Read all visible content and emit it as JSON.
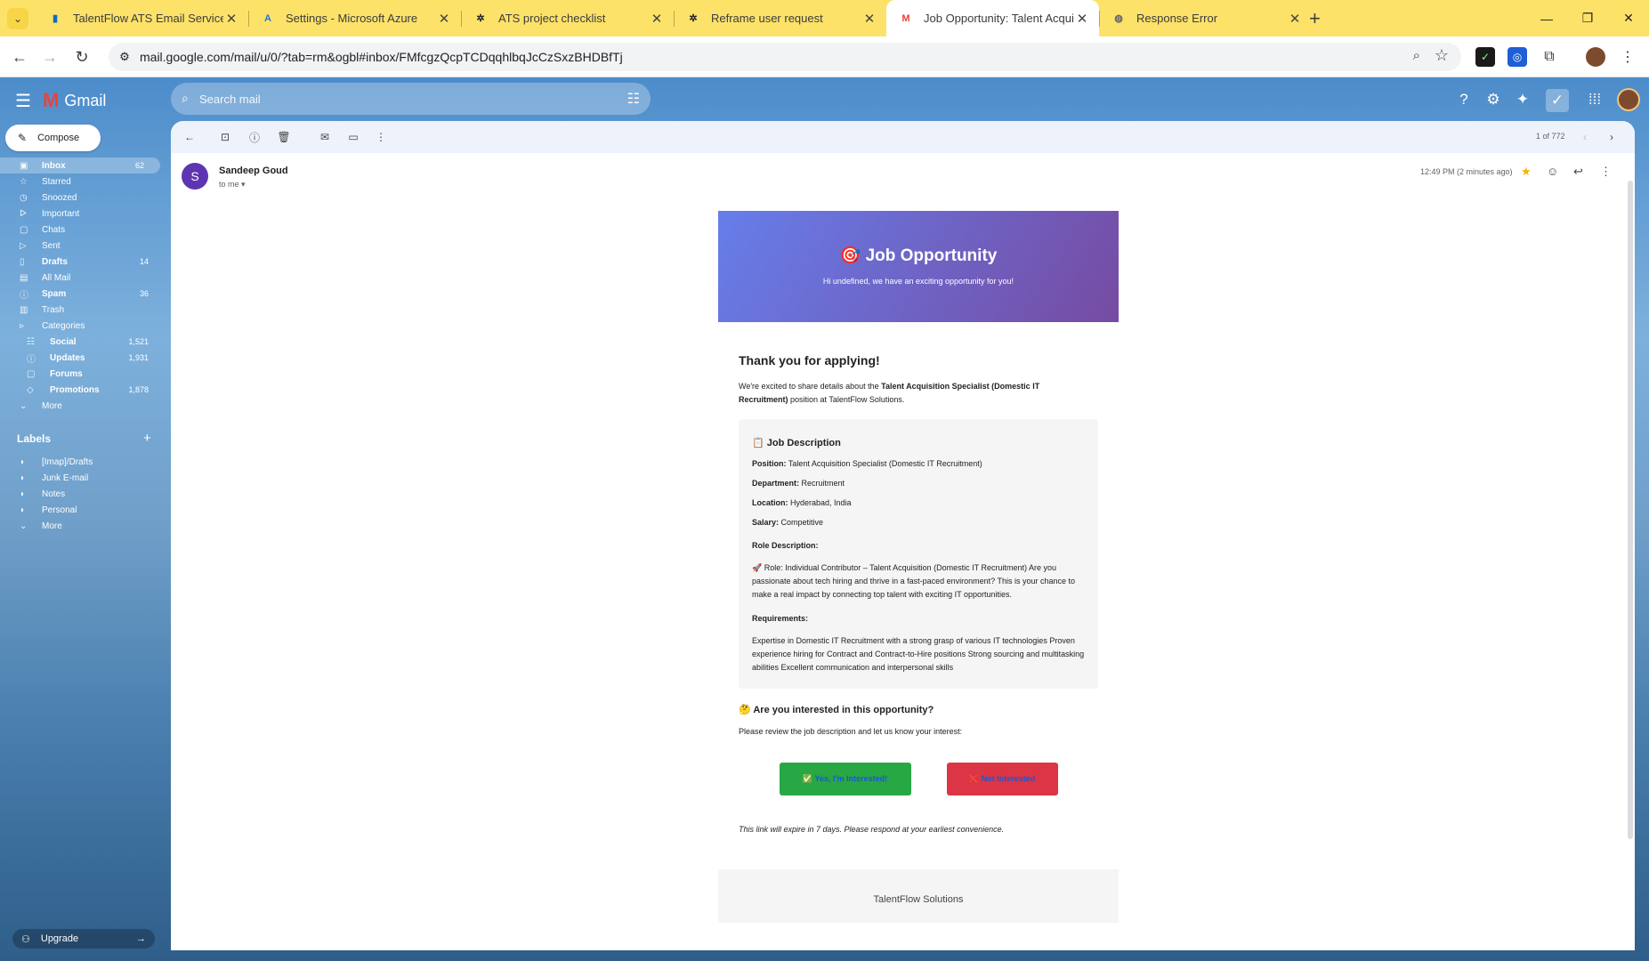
{
  "browser": {
    "tabs": [
      {
        "title": "TalentFlow ATS Email Service - M",
        "icon": "ms-docs-icon",
        "color": "#0f6cbd"
      },
      {
        "title": "Settings - Microsoft Azure",
        "icon": "azure-icon",
        "color": "#1f78d1"
      },
      {
        "title": "ATS project checklist",
        "icon": "openai-icon",
        "color": "#202124"
      },
      {
        "title": "Reframe user request",
        "icon": "openai-icon",
        "color": "#202124"
      },
      {
        "title": "Job Opportunity: Talent Acquisi",
        "icon": "gmail-icon",
        "color": "#ea4335",
        "active": true
      },
      {
        "title": "Response Error",
        "icon": "globe-icon",
        "color": "#5f6368"
      }
    ],
    "url": "mail.google.com/mail/u/0/?tab=rm&ogbl#inbox/FMfcgzQcpTCDqqhlbqJcCzSxzBHDBfTj"
  },
  "gmail": {
    "logo_text": "Gmail",
    "search_placeholder": "Search mail",
    "compose_label": "Compose",
    "nav": [
      {
        "label": "Inbox",
        "count": "62",
        "icon": "inbox-icon",
        "bold": true,
        "active": true
      },
      {
        "label": "Starred",
        "count": "",
        "icon": "star-icon"
      },
      {
        "label": "Snoozed",
        "count": "",
        "icon": "clock-icon"
      },
      {
        "label": "Important",
        "count": "",
        "icon": "important-icon"
      },
      {
        "label": "Chats",
        "count": "",
        "icon": "chat-icon"
      },
      {
        "label": "Sent",
        "count": "",
        "icon": "send-icon"
      },
      {
        "label": "Drafts",
        "count": "14",
        "icon": "draft-icon",
        "bold": true
      },
      {
        "label": "All Mail",
        "count": "",
        "icon": "all-mail-icon"
      },
      {
        "label": "Spam",
        "count": "36",
        "icon": "spam-icon",
        "bold": true
      },
      {
        "label": "Trash",
        "count": "",
        "icon": "trash-icon"
      },
      {
        "label": "Categories",
        "count": "",
        "icon": "label-icon"
      }
    ],
    "categories": [
      {
        "label": "Social",
        "count": "1,521",
        "icon": "people-icon"
      },
      {
        "label": "Updates",
        "count": "1,931",
        "icon": "info-icon"
      },
      {
        "label": "Forums",
        "count": "",
        "icon": "forum-icon"
      },
      {
        "label": "Promotions",
        "count": "1,878",
        "icon": "tag-icon"
      }
    ],
    "more_label": "More",
    "labels_title": "Labels",
    "labels": [
      "[Imap]/Drafts",
      "Junk E-mail",
      "Notes",
      "Personal"
    ],
    "labels_more": "More",
    "upgrade_label": "Upgrade",
    "pager": "1 of 772"
  },
  "message": {
    "sender_initial": "S",
    "sender_name": "Sandeep Goud",
    "to": "to me",
    "time": "12:49 PM (2 minutes ago)"
  },
  "email": {
    "banner_title": "🎯 Job Opportunity",
    "banner_sub": "Hi undefined, we have an exciting opportunity for you!",
    "thanks": "Thank you for applying!",
    "intro_pre": "We're excited to share details about the ",
    "intro_bold": "Talent Acquisition Specialist (Domestic IT Recruitment)",
    "intro_post": " position at TalentFlow Solutions.",
    "jd_title": "📋 Job Description",
    "position_label": "Position:",
    "position": " Talent Acquisition Specialist (Domestic IT Recruitment)",
    "department_label": "Department:",
    "department": " Recruitment",
    "location_label": "Location:",
    "location": " Hyderabad, India",
    "salary_label": "Salary:",
    "salary": " Competitive",
    "role_label": "Role Description:",
    "role_text": "🚀 Role: Individual Contributor – Talent Acquisition (Domestic IT Recruitment) Are you passionate about tech hiring and thrive in a fast-paced environment? This is your chance to make a real impact by connecting top talent with exciting IT opportunities.",
    "req_label": "Requirements:",
    "req_text": "Expertise in Domestic IT Recruitment with a strong grasp of various IT technologies Proven experience hiring for Contract and Contract-to-Hire positions Strong sourcing and multitasking abilities Excellent communication and interpersonal skills",
    "question": "🤔 Are you interested in this opportunity?",
    "question_sub": "Please review the job description and let us know your interest:",
    "yes_btn": "✅ Yes, I'm Interested!",
    "no_btn": "❌ Not Interested",
    "expire": "This link will expire in 7 days. Please respond at your earliest convenience.",
    "footer": "TalentFlow Solutions"
  }
}
